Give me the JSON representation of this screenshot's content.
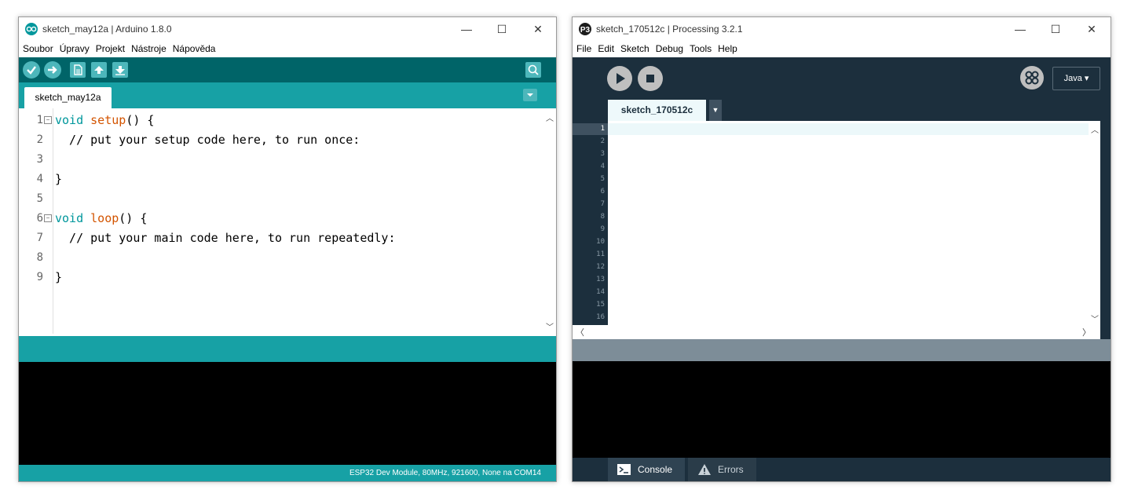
{
  "arduino": {
    "title": "sketch_may12a | Arduino 1.8.0",
    "menu": [
      "Soubor",
      "Úpravy",
      "Projekt",
      "Nástroje",
      "Nápověda"
    ],
    "toolbar": {
      "verify_icon": "check-icon",
      "upload_icon": "arrow-right-icon",
      "new_icon": "new-file-icon",
      "open_icon": "arrow-up-icon",
      "save_icon": "arrow-down-icon",
      "serial_monitor_icon": "magnifier-icon"
    },
    "tab": "sketch_may12a",
    "line_numbers": [
      "1",
      "2",
      "3",
      "4",
      "5",
      "6",
      "7",
      "8",
      "9"
    ],
    "code": {
      "l1_kw": "void",
      "l1_fn": "setup",
      "l1_rest": "() {",
      "l2": "  // put your setup code here, to run once:",
      "l4": "}",
      "l6_kw": "void",
      "l6_fn": "loop",
      "l6_rest": "() {",
      "l7": "  // put your main code here, to run repeatedly:",
      "l9": "}"
    },
    "board_status": "ESP32 Dev Module, 80MHz, 921600, None na COM14",
    "colors": {
      "teal_dark": "#006468",
      "teal": "#17a1a5",
      "button": "#4db7bb"
    }
  },
  "processing": {
    "title": "sketch_170512c | Processing 3.2.1",
    "menu": [
      "File",
      "Edit",
      "Sketch",
      "Debug",
      "Tools",
      "Help"
    ],
    "mode": "Java ▾",
    "tab": "sketch_170512c",
    "tab_menu": "▼",
    "line_numbers": [
      "1",
      "2",
      "3",
      "4",
      "5",
      "6",
      "7",
      "8",
      "9",
      "10",
      "11",
      "12",
      "13",
      "14",
      "15",
      "16"
    ],
    "footer_tabs": {
      "console": "Console",
      "errors": "Errors"
    },
    "colors": {
      "navy": "#1c2f3d",
      "status": "#7d8d98",
      "current_line": "#ecf8fa"
    }
  }
}
